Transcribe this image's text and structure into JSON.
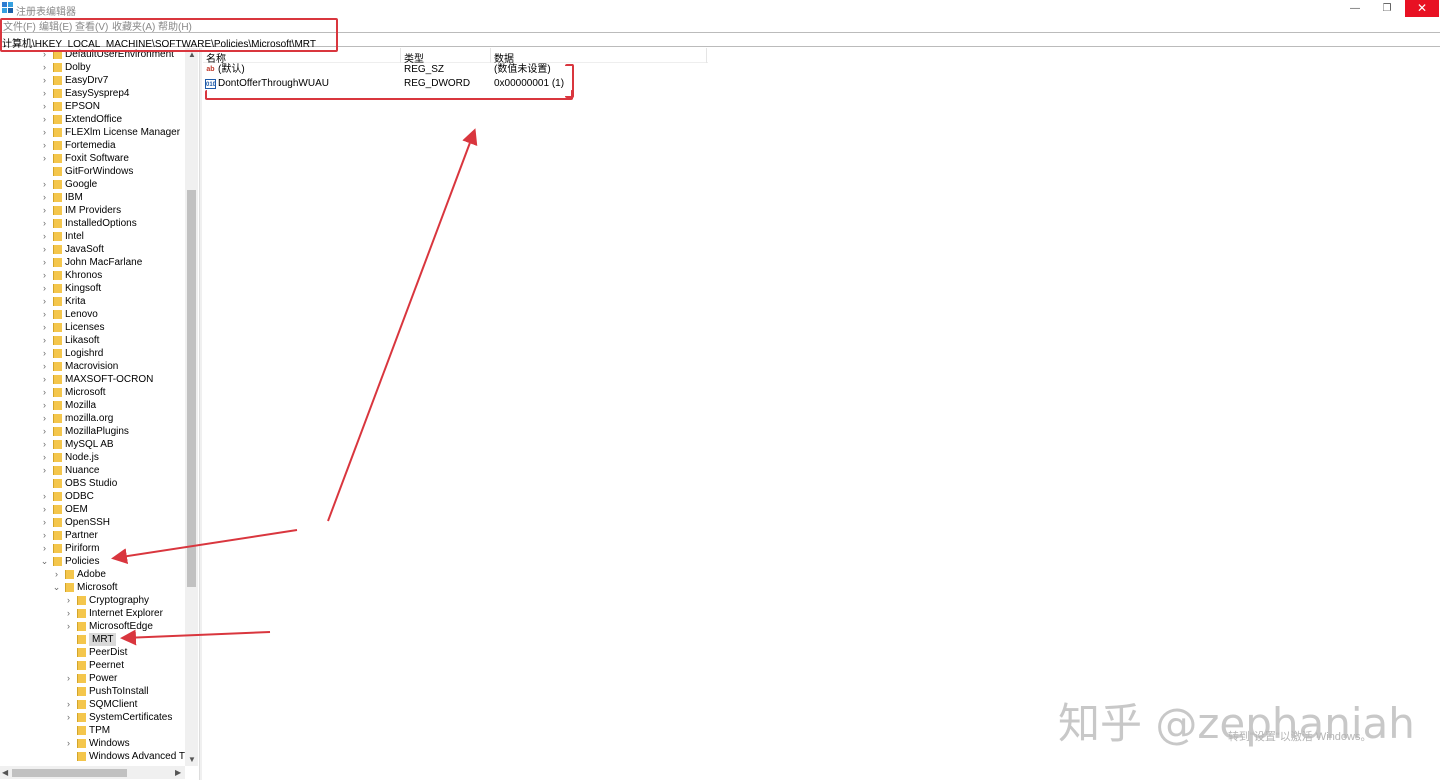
{
  "window": {
    "title": "注册表编辑器",
    "minimize_glyph": "—",
    "restore_glyph": "❐",
    "close_glyph": "✕",
    "icon": "regedit-icon"
  },
  "menu": [
    "文件(F)",
    "编辑(E)",
    "查看(V)",
    "收藏夹(A)",
    "帮助(H)"
  ],
  "address": "计算机\\HKEY_LOCAL_MACHINE\\SOFTWARE\\Policies\\Microsoft\\MRT",
  "tree": [
    {
      "label": "DefaultUserEnvironment",
      "level": 1,
      "expand": "collapsed"
    },
    {
      "label": "Dolby",
      "level": 1,
      "expand": "collapsed"
    },
    {
      "label": "EasyDrv7",
      "level": 1,
      "expand": "collapsed"
    },
    {
      "label": "EasySysprep4",
      "level": 1,
      "expand": "collapsed"
    },
    {
      "label": "EPSON",
      "level": 1,
      "expand": "collapsed"
    },
    {
      "label": "ExtendOffice",
      "level": 1,
      "expand": "collapsed"
    },
    {
      "label": "FLEXlm License Manager",
      "level": 1,
      "expand": "collapsed"
    },
    {
      "label": "Fortemedia",
      "level": 1,
      "expand": "collapsed"
    },
    {
      "label": "Foxit Software",
      "level": 1,
      "expand": "collapsed"
    },
    {
      "label": "GitForWindows",
      "level": 1,
      "expand": "none"
    },
    {
      "label": "Google",
      "level": 1,
      "expand": "collapsed"
    },
    {
      "label": "IBM",
      "level": 1,
      "expand": "collapsed"
    },
    {
      "label": "IM Providers",
      "level": 1,
      "expand": "collapsed"
    },
    {
      "label": "InstalledOptions",
      "level": 1,
      "expand": "collapsed"
    },
    {
      "label": "Intel",
      "level": 1,
      "expand": "collapsed"
    },
    {
      "label": "JavaSoft",
      "level": 1,
      "expand": "collapsed"
    },
    {
      "label": "John MacFarlane",
      "level": 1,
      "expand": "collapsed"
    },
    {
      "label": "Khronos",
      "level": 1,
      "expand": "collapsed"
    },
    {
      "label": "Kingsoft",
      "level": 1,
      "expand": "collapsed"
    },
    {
      "label": "Krita",
      "level": 1,
      "expand": "collapsed"
    },
    {
      "label": "Lenovo",
      "level": 1,
      "expand": "collapsed"
    },
    {
      "label": "Licenses",
      "level": 1,
      "expand": "collapsed"
    },
    {
      "label": "Likasoft",
      "level": 1,
      "expand": "collapsed"
    },
    {
      "label": "Logishrd",
      "level": 1,
      "expand": "collapsed"
    },
    {
      "label": "Macrovision",
      "level": 1,
      "expand": "collapsed"
    },
    {
      "label": "MAXSOFT-OCRON",
      "level": 1,
      "expand": "collapsed"
    },
    {
      "label": "Microsoft",
      "level": 1,
      "expand": "collapsed"
    },
    {
      "label": "Mozilla",
      "level": 1,
      "expand": "collapsed"
    },
    {
      "label": "mozilla.org",
      "level": 1,
      "expand": "collapsed"
    },
    {
      "label": "MozillaPlugins",
      "level": 1,
      "expand": "collapsed"
    },
    {
      "label": "MySQL AB",
      "level": 1,
      "expand": "collapsed"
    },
    {
      "label": "Node.js",
      "level": 1,
      "expand": "collapsed"
    },
    {
      "label": "Nuance",
      "level": 1,
      "expand": "collapsed"
    },
    {
      "label": "OBS Studio",
      "level": 1,
      "expand": "none"
    },
    {
      "label": "ODBC",
      "level": 1,
      "expand": "collapsed"
    },
    {
      "label": "OEM",
      "level": 1,
      "expand": "collapsed"
    },
    {
      "label": "OpenSSH",
      "level": 1,
      "expand": "collapsed"
    },
    {
      "label": "Partner",
      "level": 1,
      "expand": "collapsed"
    },
    {
      "label": "Piriform",
      "level": 1,
      "expand": "collapsed"
    },
    {
      "label": "Policies",
      "level": 1,
      "expand": "expanded"
    },
    {
      "label": "Adobe",
      "level": 2,
      "expand": "collapsed"
    },
    {
      "label": "Microsoft",
      "level": 2,
      "expand": "expanded"
    },
    {
      "label": "Cryptography",
      "level": 3,
      "expand": "collapsed"
    },
    {
      "label": "Internet Explorer",
      "level": 3,
      "expand": "collapsed"
    },
    {
      "label": "MicrosoftEdge",
      "level": 3,
      "expand": "collapsed"
    },
    {
      "label": "MRT",
      "level": 3,
      "expand": "none",
      "selected": true
    },
    {
      "label": "PeerDist",
      "level": 3,
      "expand": "none"
    },
    {
      "label": "Peernet",
      "level": 3,
      "expand": "none"
    },
    {
      "label": "Power",
      "level": 3,
      "expand": "collapsed"
    },
    {
      "label": "PushToInstall",
      "level": 3,
      "expand": "none"
    },
    {
      "label": "SQMClient",
      "level": 3,
      "expand": "collapsed"
    },
    {
      "label": "SystemCertificates",
      "level": 3,
      "expand": "collapsed"
    },
    {
      "label": "TPM",
      "level": 3,
      "expand": "none"
    },
    {
      "label": "Windows",
      "level": 3,
      "expand": "collapsed"
    },
    {
      "label": "Windows Advanced Th",
      "level": 3,
      "expand": "none"
    }
  ],
  "columns": {
    "name": "名称",
    "type": "类型",
    "data": "数据"
  },
  "values": [
    {
      "icon": "ab",
      "name": "(默认)",
      "type": "REG_SZ",
      "data": "(数值未设置)"
    },
    {
      "icon": "010",
      "name": "DontOfferThroughWUAU",
      "type": "REG_DWORD",
      "data": "0x00000001 (1)"
    }
  ],
  "scroll": {
    "up": "▲",
    "down": "▼",
    "left": "◀",
    "right": "▶"
  },
  "watermark": "知乎 @zephaniah",
  "activation": "转到\"设置\"以激活 Windows。",
  "annotation_color": "#d9363e"
}
